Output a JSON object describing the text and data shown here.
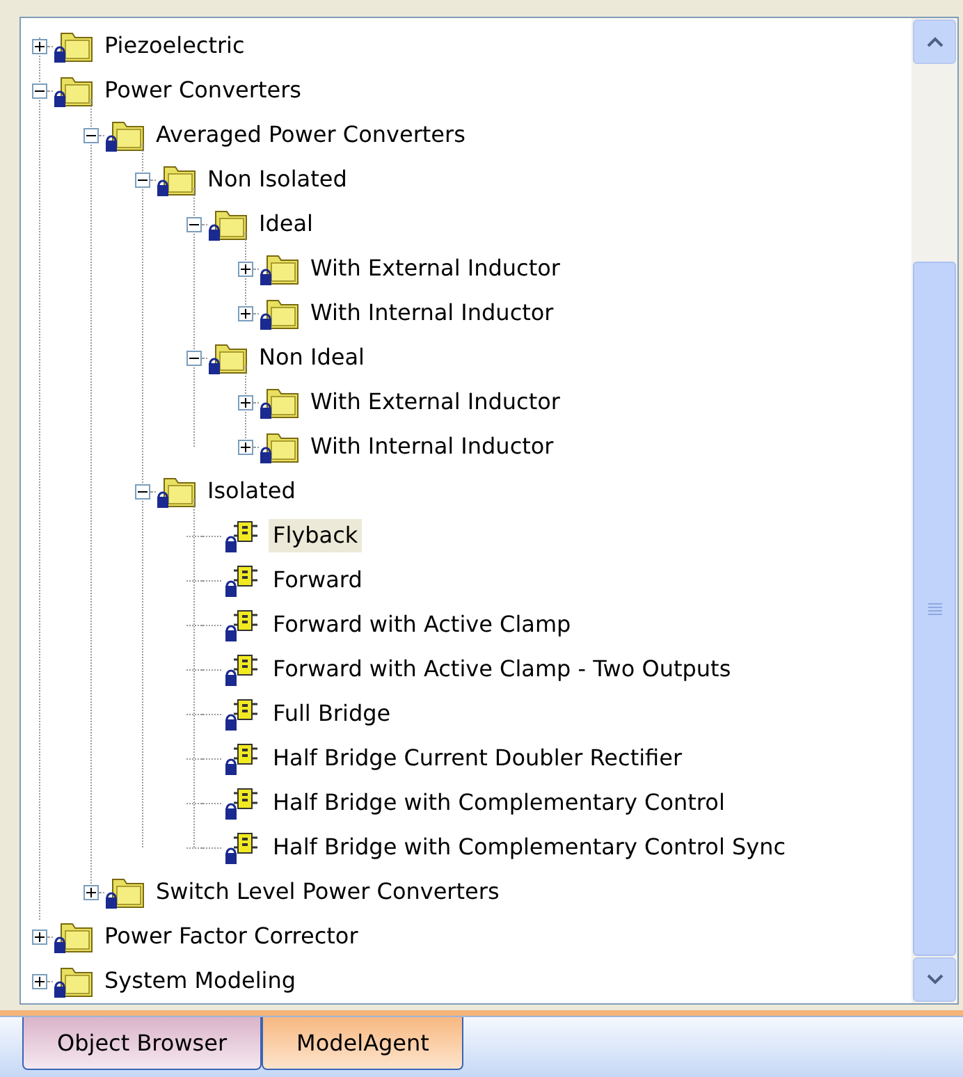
{
  "tree": [
    {
      "label": "Piezoelectric",
      "kind": "folder",
      "expanded": false,
      "selected": false
    },
    {
      "label": "Power Converters",
      "kind": "folder",
      "expanded": true,
      "selected": false,
      "children": [
        {
          "label": "Averaged Power Converters",
          "kind": "folder",
          "expanded": true,
          "selected": false,
          "children": [
            {
              "label": "Non Isolated",
              "kind": "folder",
              "expanded": true,
              "selected": false,
              "children": [
                {
                  "label": "Ideal",
                  "kind": "folder",
                  "expanded": true,
                  "selected": false,
                  "children": [
                    {
                      "label": "With External Inductor",
                      "kind": "folder",
                      "expanded": false,
                      "selected": false
                    },
                    {
                      "label": "With Internal Inductor",
                      "kind": "folder",
                      "expanded": false,
                      "selected": false
                    }
                  ]
                },
                {
                  "label": "Non Ideal",
                  "kind": "folder",
                  "expanded": true,
                  "selected": false,
                  "children": [
                    {
                      "label": "With External Inductor",
                      "kind": "folder",
                      "expanded": false,
                      "selected": false
                    },
                    {
                      "label": "With Internal Inductor",
                      "kind": "folder",
                      "expanded": false,
                      "selected": false
                    }
                  ]
                }
              ]
            },
            {
              "label": "Isolated",
              "kind": "folder",
              "expanded": true,
              "selected": false,
              "children": [
                {
                  "label": "Flyback",
                  "kind": "component",
                  "selected": true
                },
                {
                  "label": "Forward",
                  "kind": "component",
                  "selected": false
                },
                {
                  "label": "Forward with Active Clamp",
                  "kind": "component",
                  "selected": false
                },
                {
                  "label": "Forward with Active Clamp - Two Outputs",
                  "kind": "component",
                  "selected": false
                },
                {
                  "label": "Full Bridge",
                  "kind": "component",
                  "selected": false
                },
                {
                  "label": "Half Bridge Current Doubler Rectifier",
                  "kind": "component",
                  "selected": false
                },
                {
                  "label": "Half Bridge with Complementary Control",
                  "kind": "component",
                  "selected": false
                },
                {
                  "label": "Half Bridge with Complementary Control Sync",
                  "kind": "component",
                  "selected": false
                }
              ]
            }
          ]
        },
        {
          "label": "Switch Level Power Converters",
          "kind": "folder",
          "expanded": false,
          "selected": false
        }
      ]
    },
    {
      "label": "Power Factor Corrector",
      "kind": "folder",
      "expanded": false,
      "selected": false
    },
    {
      "label": "System Modeling",
      "kind": "folder",
      "expanded": false,
      "selected": false
    }
  ],
  "tabs": [
    {
      "label": "Object Browser",
      "selected": false
    },
    {
      "label": "ModelAgent",
      "selected": true
    }
  ]
}
